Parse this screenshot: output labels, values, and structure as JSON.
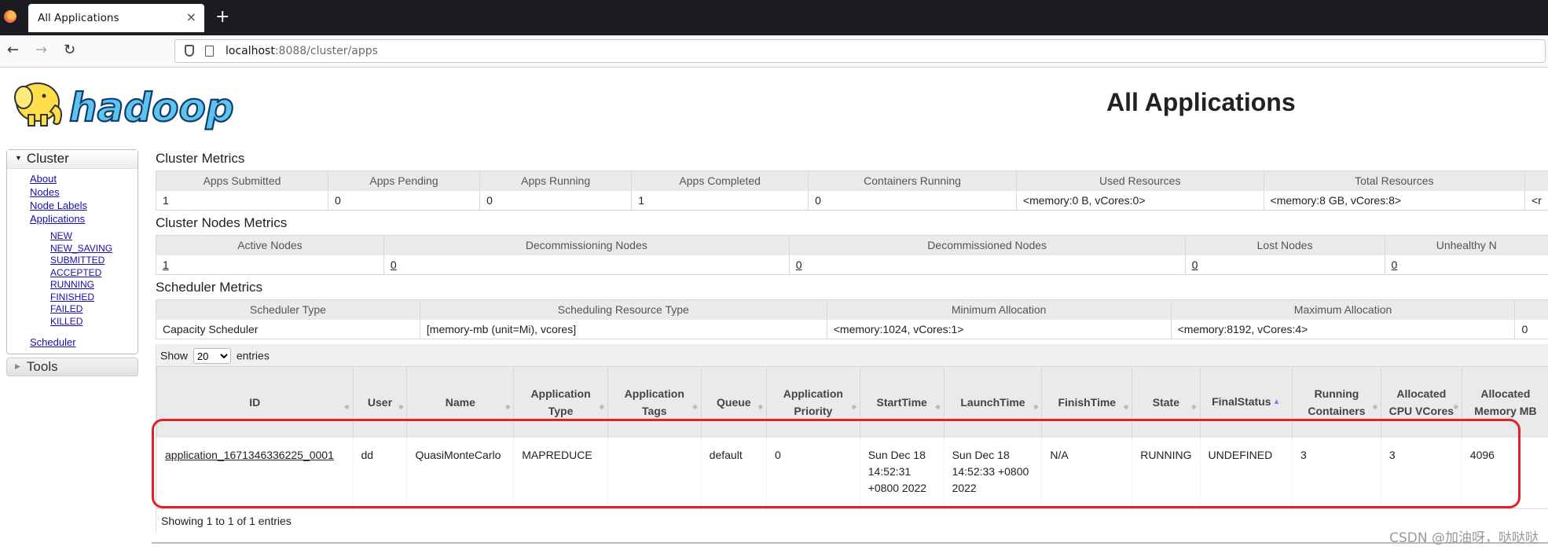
{
  "browser": {
    "tab_title": "All Applications",
    "close_glyph": "×",
    "new_tab_glyph": "+",
    "url_host": "localhost",
    "url_rest": ":8088/cluster/apps",
    "back_glyph": "←",
    "forward_glyph": "→",
    "reload_glyph": "↻"
  },
  "page": {
    "title": "All Applications",
    "logo_text": "hadoop"
  },
  "sidebar": {
    "cluster_label": "Cluster",
    "cluster_links": [
      "About",
      "Nodes",
      "Node Labels",
      "Applications"
    ],
    "app_states": [
      "NEW",
      "NEW_SAVING",
      "SUBMITTED",
      "ACCEPTED",
      "RUNNING",
      "FINISHED",
      "FAILED",
      "KILLED"
    ],
    "scheduler_link": "Scheduler",
    "tools_label": "Tools"
  },
  "cluster_metrics": {
    "title": "Cluster Metrics",
    "headers": [
      "Apps Submitted",
      "Apps Pending",
      "Apps Running",
      "Apps Completed",
      "Containers Running",
      "Used Resources",
      "Total Resources",
      ""
    ],
    "values": [
      "1",
      "0",
      "0",
      "1",
      "0",
      "<memory:0 B, vCores:0>",
      "<memory:8 GB, vCores:8>",
      "<r"
    ]
  },
  "nodes_metrics": {
    "title": "Cluster Nodes Metrics",
    "headers": [
      "Active Nodes",
      "Decommissioning Nodes",
      "Decommissioned Nodes",
      "Lost Nodes",
      "Unhealthy N"
    ],
    "values": [
      "1",
      "0",
      "0",
      "0",
      "0"
    ]
  },
  "scheduler_metrics": {
    "title": "Scheduler Metrics",
    "headers": [
      "Scheduler Type",
      "Scheduling Resource Type",
      "Minimum Allocation",
      "Maximum Allocation",
      ""
    ],
    "values": [
      "Capacity Scheduler",
      "[memory-mb (unit=Mi), vcores]",
      "<memory:1024, vCores:1>",
      "<memory:8192, vCores:4>",
      "0"
    ]
  },
  "apps_table": {
    "show_label": "Show",
    "entries_label": "entries",
    "page_size": "20",
    "headers": [
      "ID",
      "User",
      "Name",
      "Application Type",
      "Application Tags",
      "Queue",
      "Application Priority",
      "StartTime",
      "LaunchTime",
      "FinishTime",
      "State",
      "FinalStatus",
      "Running Containers",
      "Allocated CPU VCores",
      "Allocated Memory MB"
    ],
    "sort_glyph": "▲",
    "row": {
      "id": "application_1671346336225_0001",
      "user": "dd",
      "name": "QuasiMonteCarlo",
      "type": "MAPREDUCE",
      "tags": "",
      "queue": "default",
      "priority": "0",
      "start_time": "Sun Dec 18 14:52:31 +0800 2022",
      "launch_time": "Sun Dec 18 14:52:33 +0800 2022",
      "finish_time": "N/A",
      "state": "RUNNING",
      "final_status": "UNDEFINED",
      "running_containers": "3",
      "allocated_vcores": "3",
      "allocated_memory": "4096"
    },
    "footer": "Showing 1 to 1 of 1 entries"
  },
  "watermark": "CSDN @加油呀，哒哒哒"
}
